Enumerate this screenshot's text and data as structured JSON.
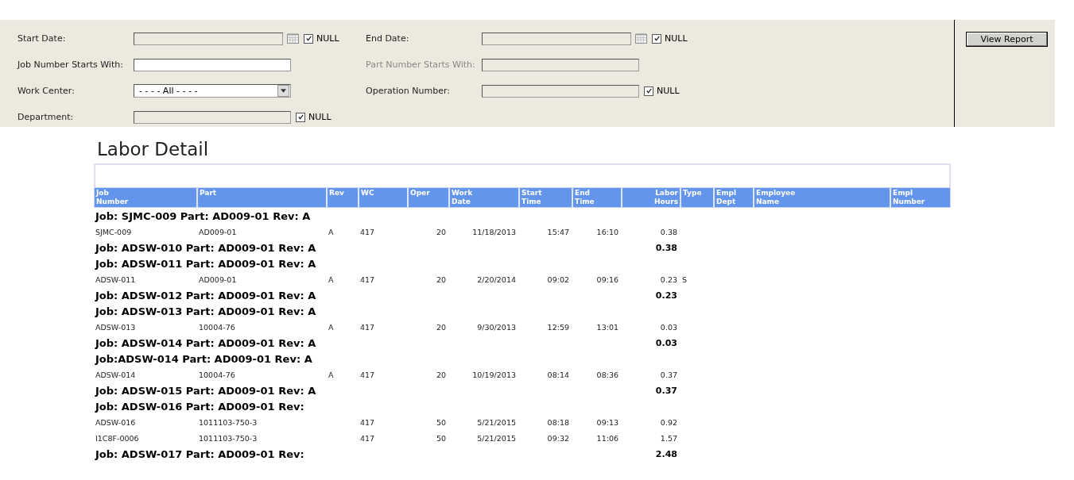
{
  "parameters": [
    {
      "label": "Start Date:",
      "kind": "date",
      "disabled": false,
      "null": {
        "label": "NULL",
        "checked": true
      }
    },
    {
      "label": "End Date:",
      "kind": "date",
      "disabled": false,
      "null": {
        "label": "NULL",
        "checked": true
      }
    },
    {
      "label": "Job Number Starts With:",
      "kind": "text",
      "disabled": false
    },
    {
      "label": "Part Number Starts With:",
      "kind": "text",
      "disabled": true
    },
    {
      "label": "Work Center:",
      "kind": "select",
      "disabled": false,
      "value": "- - - - All - - - -"
    },
    {
      "label": "Operation Number:",
      "kind": "text",
      "disabled": false,
      "null": {
        "label": "NULL",
        "checked": true
      }
    },
    {
      "label": "Department:",
      "kind": "text",
      "disabled": false,
      "null": {
        "label": "NULL",
        "checked": true
      }
    }
  ],
  "view_button": "View Report",
  "report": {
    "title": "Labor Detail",
    "columns": [
      "Job Number",
      "Part",
      "Rev",
      "WC",
      "Oper",
      "Work Date",
      "Start Time",
      "End Time",
      "Labor Hours",
      "Type",
      "Empl Dept",
      "Employee Name",
      "Empl Number"
    ],
    "rows": [
      {
        "kind": "group",
        "label": "Job: SJMC-009 Part: AD009-01  Rev: A"
      },
      {
        "kind": "detail",
        "cells": [
          "SJMC-009",
          "AD009-01",
          "A",
          "417",
          "20",
          "11/18/2013",
          "15:47",
          "16:10",
          "0.38",
          ""
        ]
      },
      {
        "kind": "group",
        "label": "Job: ADSW-010 Part: AD009-01  Rev: A",
        "total": "0.38"
      },
      {
        "kind": "group",
        "label": "Job: ADSW-011 Part: AD009-01  Rev: A"
      },
      {
        "kind": "detail",
        "cells": [
          "ADSW-011",
          "AD009-01",
          "A",
          "417",
          "20",
          "2/20/2014",
          "09:02",
          "09:16",
          "0.23",
          "S"
        ]
      },
      {
        "kind": "group",
        "label": "Job: ADSW-012 Part: AD009-01  Rev: A",
        "total": "0.23"
      },
      {
        "kind": "group",
        "label": "Job: ADSW-013 Part: AD009-01  Rev: A"
      },
      {
        "kind": "detail",
        "cells": [
          "ADSW-013",
          "10004-76",
          "A",
          "417",
          "20",
          "9/30/2013",
          "12:59",
          "13:01",
          "0.03",
          ""
        ]
      },
      {
        "kind": "group",
        "label": "Job: ADSW-014 Part: AD009-01  Rev: A",
        "total": "0.03"
      },
      {
        "kind": "group",
        "label": "Job:ADSW-014 Part: AD009-01  Rev: A"
      },
      {
        "kind": "detail",
        "cells": [
          "ADSW-014",
          "10004-76",
          "A",
          "417",
          "20",
          "10/19/2013",
          "08:14",
          "08:36",
          "0.37",
          ""
        ]
      },
      {
        "kind": "group",
        "label": "Job: ADSW-015 Part: AD009-01 Rev: A",
        "total": "0.37"
      },
      {
        "kind": "group",
        "label": "Job: ADSW-016 Part: AD009-01  Rev:"
      },
      {
        "kind": "detail",
        "cells": [
          "ADSW-016",
          "1011103-750-3",
          "",
          "417",
          "50",
          "5/21/2015",
          "08:18",
          "09:13",
          "0.92",
          ""
        ]
      },
      {
        "kind": "detail",
        "cells": [
          "I1C8F-0006",
          "1011103-750-3",
          "",
          "417",
          "50",
          "5/21/2015",
          "09:32",
          "11:06",
          "1.57",
          ""
        ]
      },
      {
        "kind": "group",
        "label": "Job: ADSW-017 Part: AD009-01  Rev:",
        "total": "2.48"
      }
    ]
  }
}
